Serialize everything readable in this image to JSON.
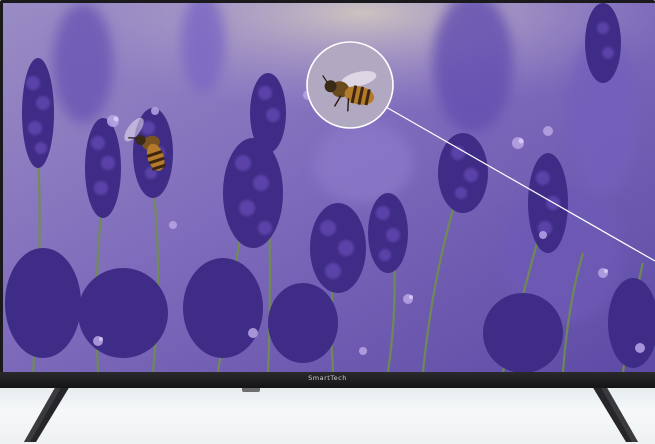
{
  "product": {
    "brand_logo": "SmartTech",
    "type": "frameless-led-tv"
  },
  "screen_content": {
    "subject": "bees-on-lavender",
    "zoom_callout": "bee-magnifier-circle"
  },
  "colors": {
    "bezel": "#1a1a1c",
    "lavender_dark": "#3b2a7a",
    "lavender_mid": "#6e57b8",
    "lavender_light": "#b9a6e6",
    "leaf_green": "#6f8f4a",
    "bee_amber": "#b37a2a"
  }
}
